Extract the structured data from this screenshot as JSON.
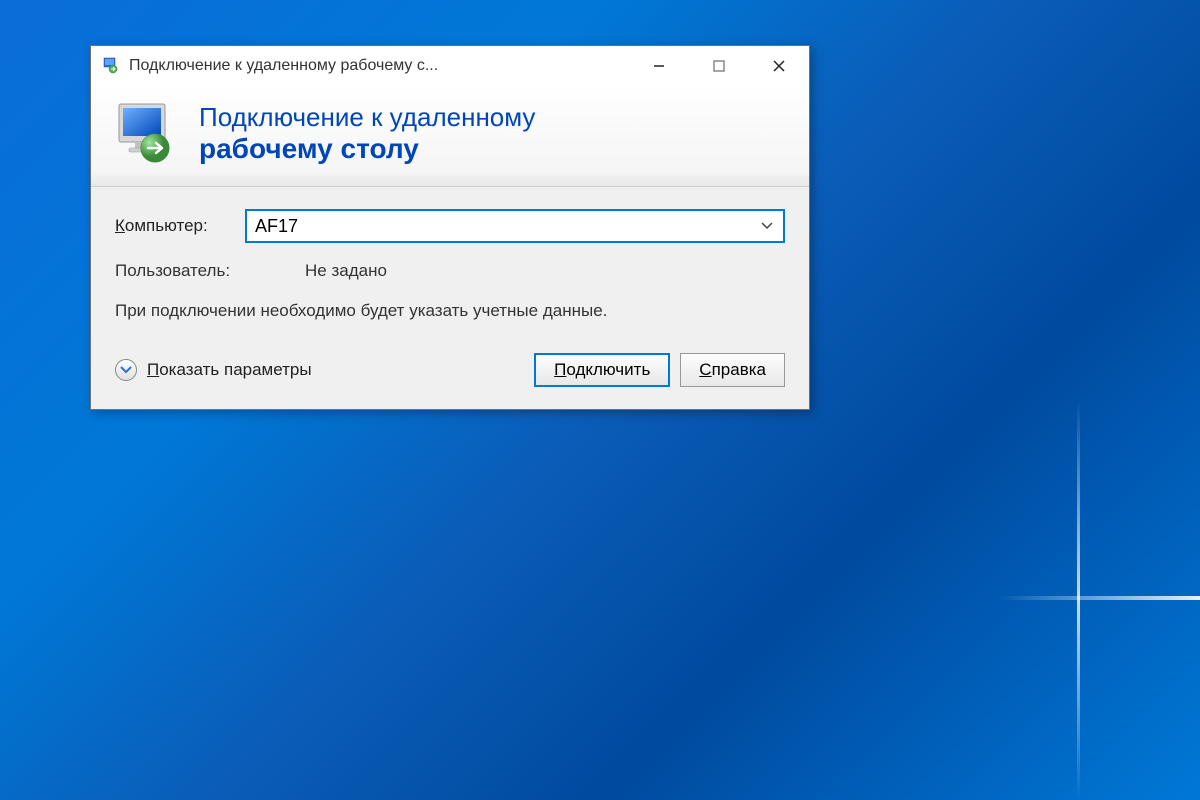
{
  "window": {
    "title": "Подключение к удаленному рабочему с..."
  },
  "header": {
    "line1": "Подключение к удаленному",
    "line2": "рабочему столу"
  },
  "form": {
    "computer_label": "Компьютер:",
    "computer_value": "AF17",
    "user_label": "Пользователь:",
    "user_value": "Не задано",
    "info_text": "При подключении необходимо будет указать учетные данные."
  },
  "footer": {
    "show_options": "Показать параметры",
    "connect": "Подключить",
    "help": "Справка"
  }
}
